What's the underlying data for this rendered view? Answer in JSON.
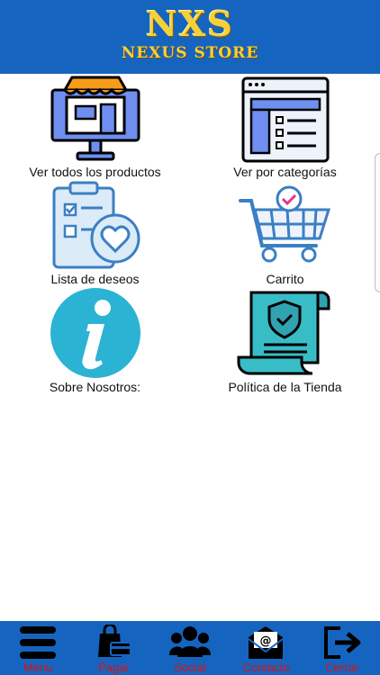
{
  "header": {
    "logo_mark": "NXS",
    "logo_name": "NEXUS STORE"
  },
  "menu": [
    {
      "label": "Ver todos los productos",
      "icon": "storefront-monitor-icon"
    },
    {
      "label": "Ver por categorías",
      "icon": "category-list-window-icon"
    },
    {
      "label": "Lista de deseos",
      "icon": "wishlist-clipboard-heart-icon"
    },
    {
      "label": "Carrito",
      "icon": "shopping-cart-icon"
    },
    {
      "label": "Sobre Nosotros:",
      "icon": "info-icon"
    },
    {
      "label": "Política de la Tienda",
      "icon": "policy-scroll-shield-icon"
    }
  ],
  "bottom_nav": [
    {
      "label": "Menu",
      "icon": "hamburger-icon"
    },
    {
      "label": "Pagar",
      "icon": "shopping-bag-card-icon"
    },
    {
      "label": "Social",
      "icon": "users-group-icon"
    },
    {
      "label": "Contacto",
      "icon": "envelope-at-icon"
    },
    {
      "label": "Cerrar",
      "icon": "exit-icon"
    }
  ],
  "colors": {
    "header_bg": "#1565c0",
    "nav_label": "#e01010",
    "logo_gold": "#f5d03a"
  }
}
